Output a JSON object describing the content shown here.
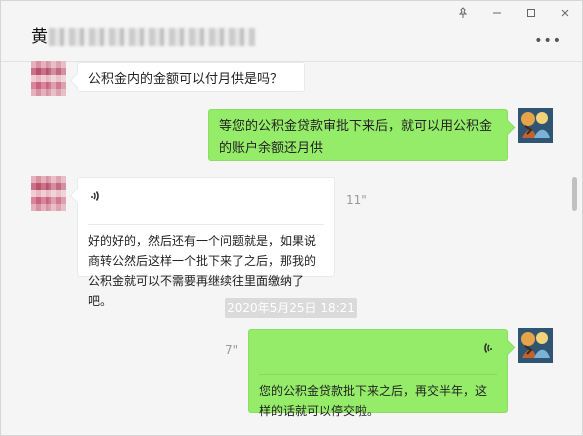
{
  "window": {
    "controls": {
      "pin_icon": "pin-icon",
      "minimize_icon": "minimize-icon",
      "maximize_icon": "maximize-icon",
      "close_icon": "close-icon"
    }
  },
  "chat": {
    "title_visible": "黄",
    "more_label": "•••"
  },
  "messages": {
    "m1_text": "公积金内的金额可以付月供是吗？",
    "m2_text": "等您的公积金贷款审批下来后，就可以用公积金的账户余额还月供",
    "m3_voice_duration": "11\"",
    "m3_transcript": "好的好的，然后还有一个问题就是，如果说商转公然后这样一个批下来了之后，那我的公积金就可以不需要再继续往里面缴纳了吧。",
    "timestamp": "2020年5月25日 18:21",
    "m4_voice_duration": "7\"",
    "m4_transcript": "您的公积金贷款批下来之后，再交半年，这样的话就可以停交啦。"
  },
  "colors": {
    "background": "#f5f5f5",
    "green_bubble": "#95ec69",
    "white_bubble": "#ffffff",
    "timestamp_bg": "#dadada"
  }
}
